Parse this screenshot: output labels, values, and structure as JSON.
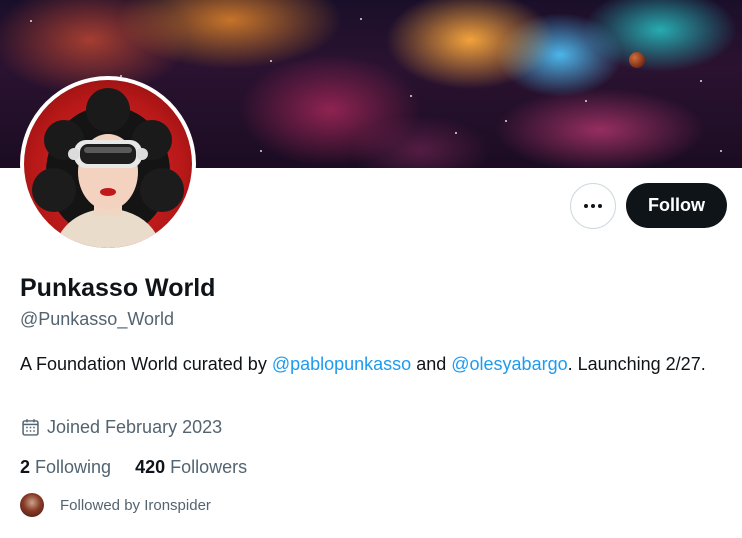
{
  "profile": {
    "display_name": "Punkasso World",
    "handle": "@Punkasso_World",
    "bio": {
      "prefix": "A Foundation World curated by ",
      "mention_1": "@pablopunkasso",
      "middle": " and ",
      "mention_2": "@olesyabargo",
      "suffix": ". Launching 2/27."
    },
    "joined": "Joined February 2023",
    "following_count": "2",
    "following_label": "Following",
    "followers_count": "420",
    "followers_label": "Followers",
    "followed_by": "Followed by Ironspider"
  },
  "actions": {
    "more_icon": "more-horizontal-icon",
    "follow_label": "Follow"
  },
  "icons": {
    "joined": "calendar-icon"
  },
  "colors": {
    "link": "#1d9bf0",
    "primary_text": "#0f1419",
    "secondary_text": "#536471",
    "follow_button_bg": "#0f1419"
  }
}
